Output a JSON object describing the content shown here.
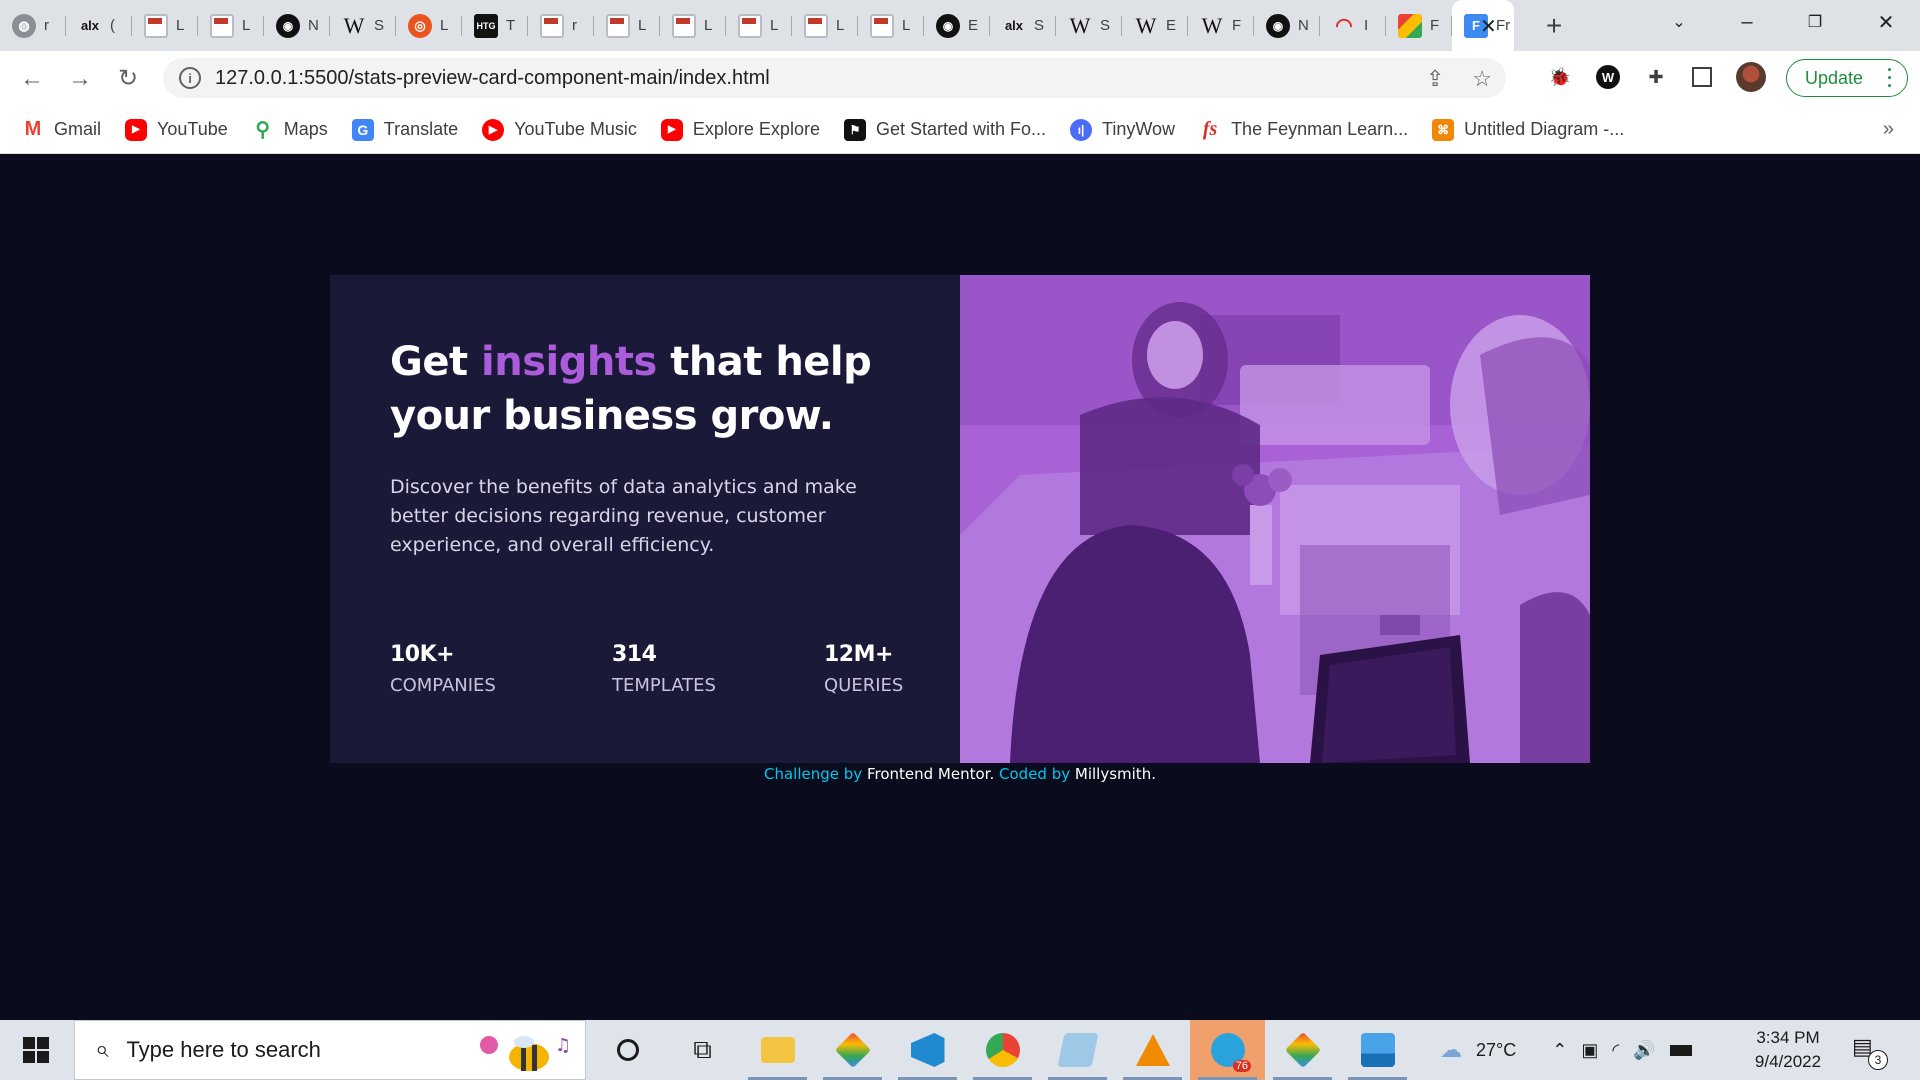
{
  "browser": {
    "tabs": [
      {
        "icon": "globe-icon",
        "title": "r"
      },
      {
        "icon": "alx-icon",
        "title": "("
      },
      {
        "icon": "document-icon",
        "title": "L"
      },
      {
        "icon": "document-icon",
        "title": "L"
      },
      {
        "icon": "github-icon",
        "title": "N"
      },
      {
        "icon": "wikipedia-icon",
        "title": "S"
      },
      {
        "icon": "ubuntu-icon",
        "title": "L"
      },
      {
        "icon": "htg-icon",
        "title": "T"
      },
      {
        "icon": "document-icon",
        "title": "r"
      },
      {
        "icon": "document-icon",
        "title": "L"
      },
      {
        "icon": "document-icon",
        "title": "L"
      },
      {
        "icon": "document-icon",
        "title": "L"
      },
      {
        "icon": "document-icon",
        "title": "L"
      },
      {
        "icon": "document-icon",
        "title": "L"
      },
      {
        "icon": "github-icon",
        "title": "E"
      },
      {
        "icon": "alx-icon",
        "title": "S"
      },
      {
        "icon": "wikipedia-icon",
        "title": "S"
      },
      {
        "icon": "wikipedia-icon",
        "title": "E"
      },
      {
        "icon": "wikipedia-icon",
        "title": "F"
      },
      {
        "icon": "github-icon",
        "title": "N"
      },
      {
        "icon": "gauge-icon",
        "title": "I"
      },
      {
        "icon": "puzzle-icon",
        "title": "F"
      }
    ],
    "active_tab": {
      "icon": "frontend-mentor-icon",
      "title": "Fr"
    },
    "new_tab_label": "+",
    "url": "127.0.0.1:5500/stats-preview-card-component-main/index.html",
    "update_label": "Update",
    "bookmarks": [
      {
        "icon": "gmail-icon",
        "label": "Gmail"
      },
      {
        "icon": "youtube-icon",
        "label": "YouTube"
      },
      {
        "icon": "maps-icon",
        "label": "Maps"
      },
      {
        "icon": "translate-icon",
        "label": "Translate"
      },
      {
        "icon": "youtube-music-icon",
        "label": "YouTube Music"
      },
      {
        "icon": "youtube-icon",
        "label": "Explore Explore"
      },
      {
        "icon": "flag-icon",
        "label": "Get Started with Fo..."
      },
      {
        "icon": "tinywow-icon",
        "label": "TinyWow"
      },
      {
        "icon": "fs-icon",
        "label": "The Feynman Learn..."
      },
      {
        "icon": "diagram-icon",
        "label": "Untitled Diagram -..."
      }
    ],
    "bookmarks_more": "»"
  },
  "card": {
    "headline_start": "Get ",
    "headline_accent": "insights",
    "headline_end": " that help your business grow.",
    "description": "Discover the benefits of data analytics and make better decisions regarding revenue, customer experience, and overall efficiency.",
    "stats": [
      {
        "value": "10K+",
        "label": "Companies"
      },
      {
        "value": "314",
        "label": "Templates"
      },
      {
        "value": "12M+",
        "label": "Queries"
      }
    ]
  },
  "attribution": {
    "challenge_by": "Challenge by",
    "frontend_mentor": "Frontend Mentor",
    "coded_by": "Coded by",
    "author": "Millysmith"
  },
  "taskbar": {
    "search_placeholder": "Type here to search",
    "weather": "27°C",
    "time": "3:34 PM",
    "date": "9/4/2022",
    "notification_count": "3",
    "telegram_badge": "76"
  },
  "colors": {
    "page_bg": "#0a0c1d",
    "card_bg": "#1b1938",
    "accent": "#aa5cdb",
    "attribution_link": "#00c8ec"
  }
}
